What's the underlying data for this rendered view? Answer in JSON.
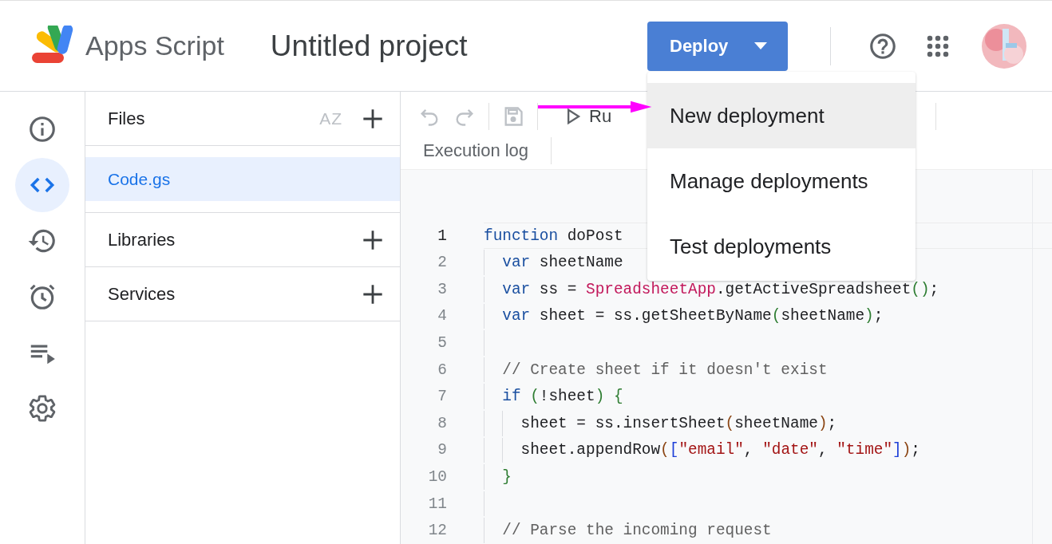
{
  "header": {
    "app_name": "Apps Script",
    "project_title": "Untitled project",
    "deploy_button": "Deploy"
  },
  "rail": [
    {
      "kind": "info",
      "selected": false
    },
    {
      "kind": "code",
      "selected": true
    },
    {
      "kind": "history",
      "selected": false
    },
    {
      "kind": "alarm",
      "selected": false
    },
    {
      "kind": "executions",
      "selected": false
    },
    {
      "kind": "settings",
      "selected": false
    }
  ],
  "files_panel": {
    "title": "Files",
    "sort_label": "AZ",
    "files": [
      {
        "name": "Code.gs",
        "selected": true
      }
    ],
    "sections": [
      {
        "label": "Libraries"
      },
      {
        "label": "Services"
      }
    ]
  },
  "toolbar": [
    {
      "kind": "undo",
      "disabled": true
    },
    {
      "kind": "redo",
      "disabled": true
    },
    {
      "kind": "save",
      "disabled": true
    },
    {
      "kind": "run",
      "label": "Ru",
      "disabled": false
    }
  ],
  "log_tab": "Execution log",
  "code": [
    {
      "number": "1",
      "current": true,
      "tokens": [
        {
          "t": "function",
          "color": "#1a4fa0"
        },
        {
          "t": " doPost",
          "color": "#202124"
        }
      ]
    },
    {
      "number": "2",
      "current": false,
      "tokens": [
        {
          "t": "  var",
          "color": "#1a4fa0"
        },
        {
          "t": " sheetName",
          "color": "#202124"
        }
      ]
    },
    {
      "number": "3",
      "current": false,
      "tokens": [
        {
          "t": "  var",
          "color": "#1a4fa0"
        },
        {
          "t": " ss = ",
          "color": "#202124"
        },
        {
          "t": "SpreadsheetApp",
          "color": "#c2185b"
        },
        {
          "t": ".getActiveSpreadsheet",
          "color": "#202124"
        },
        {
          "t": "()",
          "color": "#2e7d32"
        },
        {
          "t": ";",
          "color": "#202124"
        }
      ]
    },
    {
      "number": "4",
      "current": false,
      "tokens": [
        {
          "t": "  var",
          "color": "#1a4fa0"
        },
        {
          "t": " sheet = ss.getSheetByName",
          "color": "#202124"
        },
        {
          "t": "(",
          "color": "#2e7d32"
        },
        {
          "t": "sheetName",
          "color": "#202124"
        },
        {
          "t": ")",
          "color": "#2e7d32"
        },
        {
          "t": ";",
          "color": "#202124"
        }
      ]
    },
    {
      "number": "5",
      "current": false
    },
    {
      "number": "6",
      "current": false,
      "tokens": [
        {
          "t": "  // Create sheet if it doesn't exist",
          "color": "#616161"
        }
      ]
    },
    {
      "number": "7",
      "current": false,
      "tokens": [
        {
          "t": "  if",
          "color": "#1a4fa0"
        },
        {
          "t": " (",
          "color": "#2e7d32"
        },
        {
          "t": "!sheet",
          "color": "#202124"
        },
        {
          "t": ") {",
          "color": "#2e7d32"
        }
      ]
    },
    {
      "number": "8",
      "current": false,
      "tokens": [
        {
          "t": "    sheet = ss.insertSheet",
          "color": "#202124"
        },
        {
          "t": "(",
          "color": "#8b4513"
        },
        {
          "t": "sheetName",
          "color": "#202124"
        },
        {
          "t": ")",
          "color": "#8b4513"
        },
        {
          "t": ";",
          "color": "#202124"
        }
      ]
    },
    {
      "number": "9",
      "current": false,
      "tokens": [
        {
          "t": "    sheet.appendRow",
          "color": "#202124"
        },
        {
          "t": "(",
          "color": "#8b4513"
        },
        {
          "t": "[",
          "color": "#1e40d8"
        },
        {
          "t": "\"email\"",
          "color": "#a31515"
        },
        {
          "t": ", ",
          "color": "#202124"
        },
        {
          "t": "\"date\"",
          "color": "#a31515"
        },
        {
          "t": ", ",
          "color": "#202124"
        },
        {
          "t": "\"time\"",
          "color": "#a31515"
        },
        {
          "t": "]",
          "color": "#1e40d8"
        },
        {
          "t": ")",
          "color": "#8b4513"
        },
        {
          "t": ";",
          "color": "#202124"
        }
      ]
    },
    {
      "number": "10",
      "current": false,
      "tokens": [
        {
          "t": "  }",
          "color": "#2e7d32"
        }
      ]
    },
    {
      "number": "11",
      "current": false
    },
    {
      "number": "12",
      "current": false,
      "tokens": [
        {
          "t": "  // Parse the incoming request",
          "color": "#616161"
        }
      ]
    }
  ],
  "deploy_menu": [
    {
      "label": "New deployment",
      "selected": true
    },
    {
      "label": "Manage deployments",
      "selected": false
    },
    {
      "label": "Test deployments",
      "selected": false
    }
  ]
}
